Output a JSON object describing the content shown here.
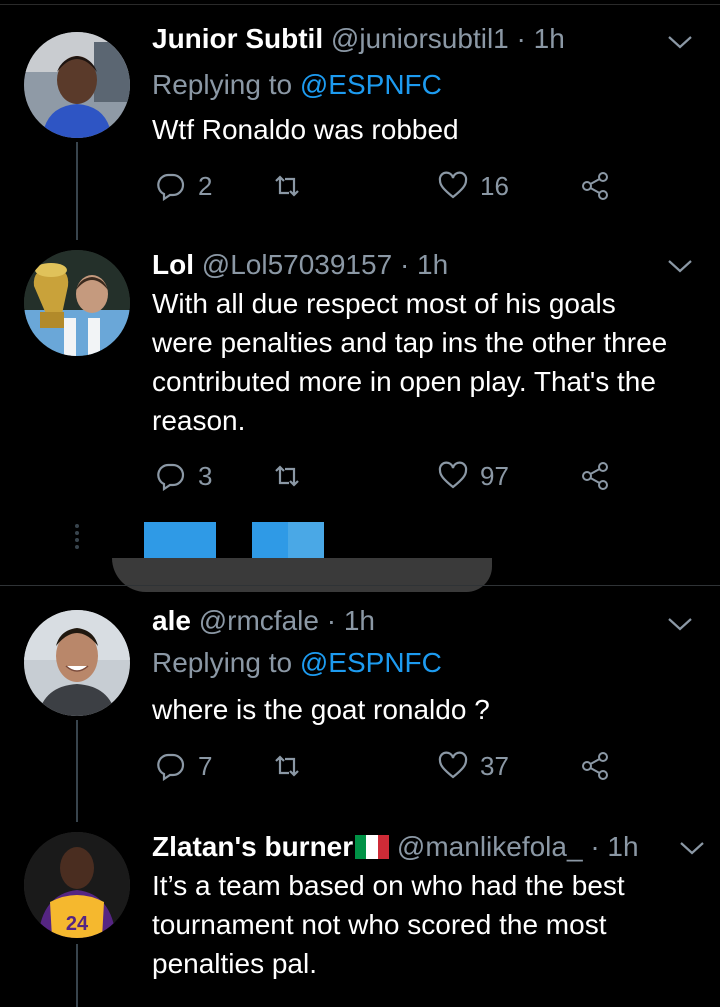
{
  "tweets": [
    {
      "name": "Junior Subtil",
      "handle": "@juniorsubtil1",
      "time": "· 1h",
      "replying_prefix": "Replying to",
      "replying_to": "@ESPNFC",
      "text": "Wtf Ronaldo was robbed",
      "replies": "2",
      "retweets": "",
      "likes": "16"
    },
    {
      "name": "Lol",
      "handle": "@Lol57039157",
      "time": "· 1h",
      "text": "With all due respect most of his goals were penalties and tap ins the other three contributed more in open play. That's the reason.",
      "replies": "3",
      "retweets": "",
      "likes": "97"
    },
    {
      "name": "ale",
      "handle": "@rmcfale",
      "time": "· 1h",
      "replying_prefix": "Replying to",
      "replying_to": "@ESPNFC",
      "text": "where is the goat ronaldo ?",
      "replies": "7",
      "retweets": "",
      "likes": "37"
    },
    {
      "name": "Zlatan's burner",
      "handle": "@manlikefola_",
      "time": "· 1h",
      "text": "It’s a team based on who had the best tournament not who scored the most penalties pal."
    }
  ],
  "icons": [
    "reply-icon",
    "retweet-icon",
    "like-icon",
    "share-icon",
    "chevron-down-icon",
    "italy-flag-icon"
  ],
  "colors": {
    "background": "#000000",
    "secondary_text": "#8b98a5",
    "accent": "#1d9bf0",
    "thread_line": "#38444d"
  }
}
